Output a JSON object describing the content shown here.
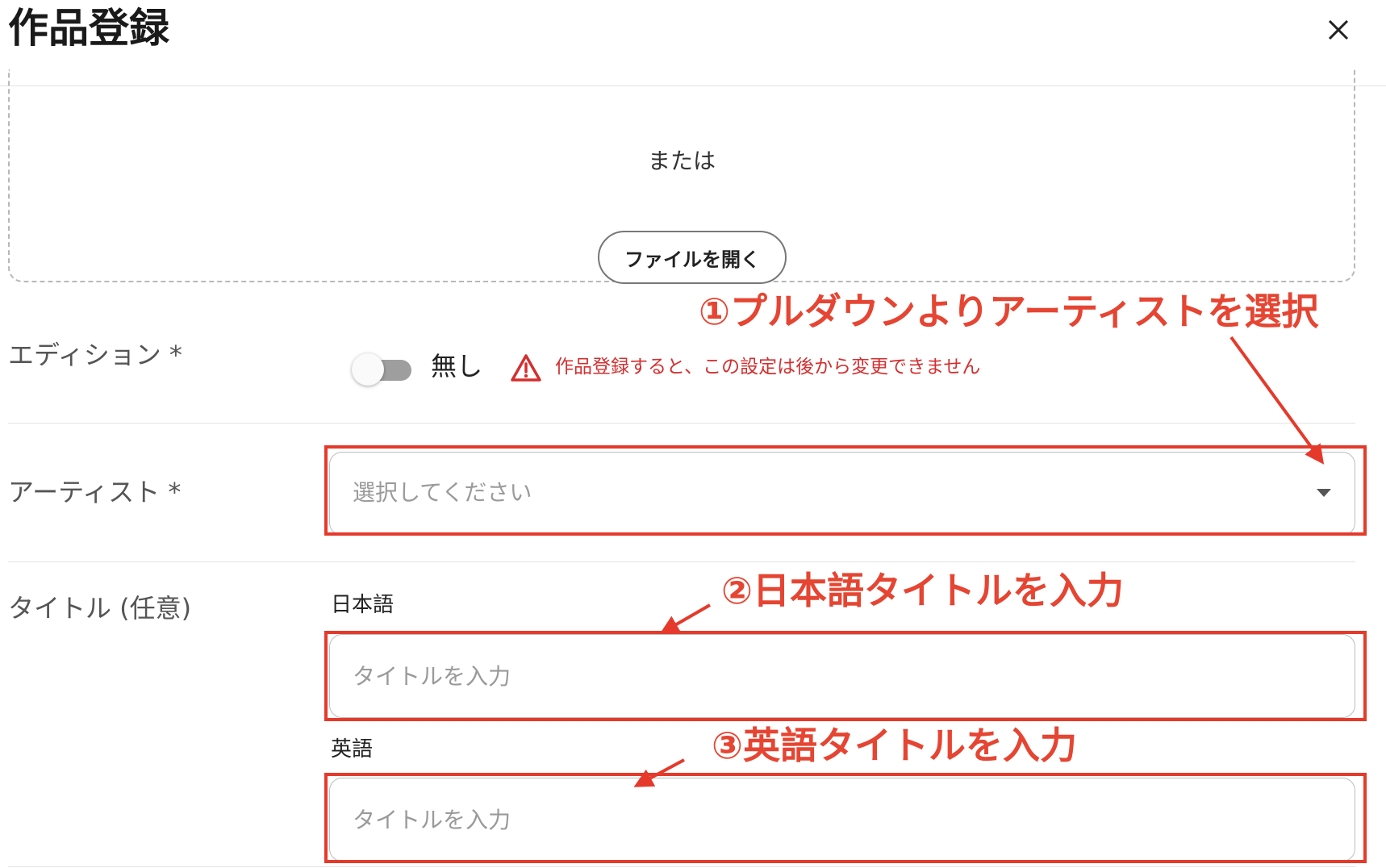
{
  "modal": {
    "title": "作品登録",
    "close_icon": "close-icon"
  },
  "upload": {
    "or_text": "または",
    "open_file_button": "ファイルを開く"
  },
  "edition": {
    "label": "エディション *",
    "toggle_state": false,
    "toggle_text": "無し",
    "warning_icon": "warning-triangle-icon",
    "warning_text": "作品登録すると、この設定は後から変更できません",
    "warning_color": "#d32f2f"
  },
  "artist": {
    "label": "アーティスト *",
    "select_placeholder": "選択してください",
    "caret_icon": "caret-down-icon"
  },
  "title": {
    "label": "タイトル (任意)",
    "japanese": {
      "label": "日本語",
      "placeholder": "タイトルを入力"
    },
    "english": {
      "label": "英語",
      "placeholder": "タイトルを入力"
    }
  },
  "annotations": {
    "step1": "①プルダウンよりアーティストを選択",
    "step2": "②日本語タイトルを入力",
    "step3": "③英語タイトルを入力",
    "color": "#e53a2b"
  }
}
